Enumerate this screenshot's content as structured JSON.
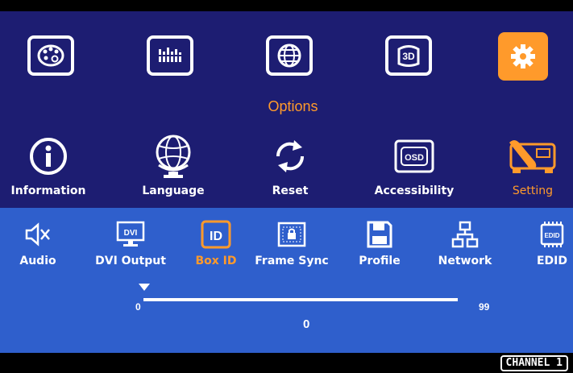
{
  "menu": {
    "categories": [
      {
        "icon": "palette-icon",
        "active": false
      },
      {
        "icon": "equalizer-icon",
        "active": false
      },
      {
        "icon": "globe-icon",
        "active": false
      },
      {
        "icon": "3d-icon",
        "active": false
      },
      {
        "icon": "gear-icon",
        "active": true
      }
    ],
    "section_title": "Options"
  },
  "options": [
    {
      "label": "Information",
      "icon": "info-icon",
      "active": false
    },
    {
      "label": "Language",
      "icon": "globe-language-icon",
      "active": false
    },
    {
      "label": "Reset",
      "icon": "reset-icon",
      "active": false
    },
    {
      "label": "Accessibility",
      "icon": "osd-icon",
      "active": false
    },
    {
      "label": "Setting",
      "icon": "wrench-setting-icon",
      "active": true
    }
  ],
  "submenu": [
    {
      "label": "Audio",
      "icon": "speaker-mute-icon",
      "active": false
    },
    {
      "label": "DVI Output",
      "icon": "dvi-monitor-icon",
      "active": false
    },
    {
      "label": "Box ID",
      "icon": "id-badge-icon",
      "active": true
    },
    {
      "label": "Frame Sync",
      "icon": "frame-sync-icon",
      "active": false
    },
    {
      "label": "Profile",
      "icon": "save-disk-icon",
      "active": false
    },
    {
      "label": "Network",
      "icon": "network-icon",
      "active": false
    },
    {
      "label": "EDID",
      "icon": "edid-chip-icon",
      "active": false
    }
  ],
  "slider": {
    "min_label": "0",
    "max_label": "99",
    "value": "0",
    "min": 0,
    "max": 99,
    "current": 0
  },
  "status": {
    "channel": "CHANNEL 1"
  },
  "colors": {
    "accent": "#ff9a2b",
    "top_bg": "#1d1d72",
    "bottom_bg": "#2f5fcc",
    "text": "#ffffff"
  }
}
